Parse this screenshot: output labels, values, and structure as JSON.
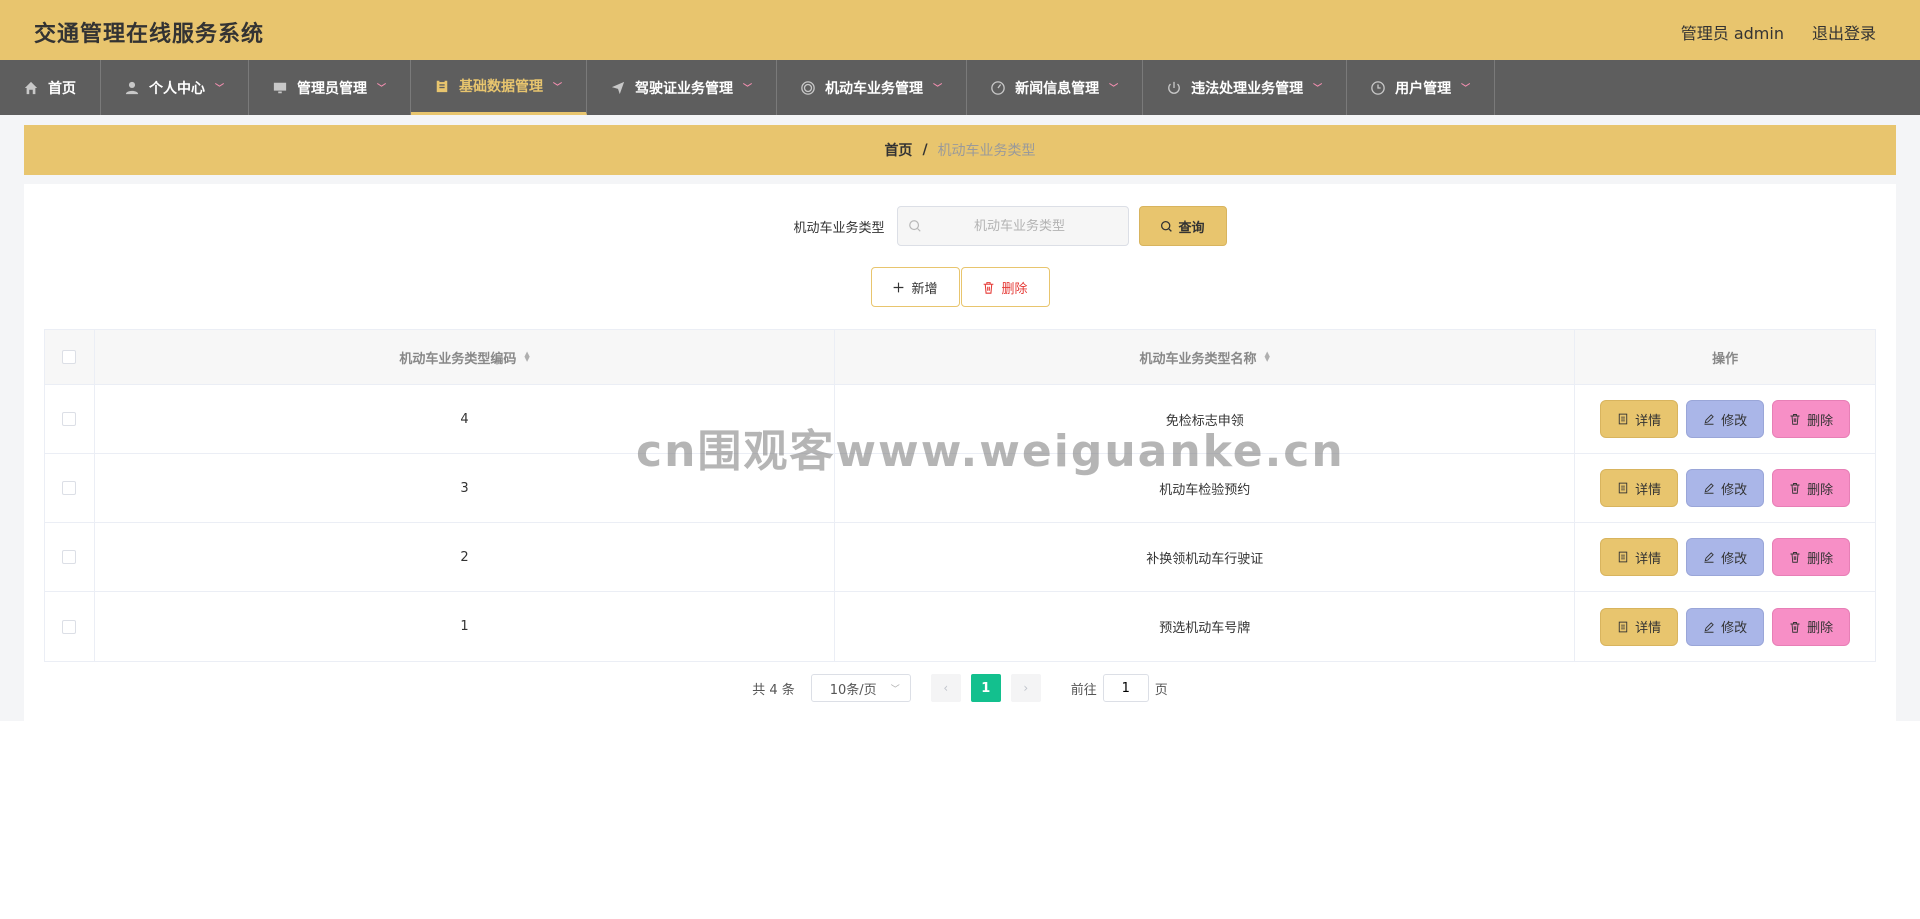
{
  "header": {
    "title": "交通管理在线服务系统",
    "user_label": "管理员 admin",
    "logout_label": "退出登录"
  },
  "nav": {
    "items": [
      {
        "label": "首页",
        "icon": "home-icon",
        "has_dropdown": false
      },
      {
        "label": "个人中心",
        "icon": "user-icon",
        "has_dropdown": true
      },
      {
        "label": "管理员管理",
        "icon": "monitor-icon",
        "has_dropdown": true
      },
      {
        "label": "基础数据管理",
        "icon": "clipboard-icon",
        "has_dropdown": true,
        "active": true
      },
      {
        "label": "驾驶证业务管理",
        "icon": "send-icon",
        "has_dropdown": true
      },
      {
        "label": "机动车业务管理",
        "icon": "target-icon",
        "has_dropdown": true
      },
      {
        "label": "新闻信息管理",
        "icon": "gauge-icon",
        "has_dropdown": true
      },
      {
        "label": "违法处理业务管理",
        "icon": "power-icon",
        "has_dropdown": true
      },
      {
        "label": "用户管理",
        "icon": "clock-icon",
        "has_dropdown": true
      }
    ],
    "chevron": "﹀"
  },
  "breadcrumb": {
    "home": "首页",
    "separator": "/",
    "current": "机动车业务类型"
  },
  "search": {
    "label": "机动车业务类型",
    "placeholder": "机动车业务类型",
    "value": "",
    "button_label": "查询"
  },
  "actions": {
    "add_label": "新增",
    "delete_label": "删除"
  },
  "table": {
    "columns": [
      "机动车业务类型编码",
      "机动车业务类型名称",
      "操作"
    ],
    "rows": [
      {
        "code": "4",
        "name": "免检标志申领"
      },
      {
        "code": "3",
        "name": "机动车检验预约"
      },
      {
        "code": "2",
        "name": "补换领机动车行驶证"
      },
      {
        "code": "1",
        "name": "预选机动车号牌"
      }
    ],
    "row_actions": {
      "detail": "详情",
      "edit": "修改",
      "delete": "删除"
    }
  },
  "pagination": {
    "total_text": "共 4 条",
    "page_size": "10条/页",
    "current_page": "1",
    "goto_prefix": "前往",
    "goto_value": "1",
    "goto_suffix": "页",
    "prev": "‹",
    "next": "›"
  },
  "watermark": "cn围观客www.weiguanke.cn",
  "colors": {
    "accent": "#e8c56e",
    "nav_bg": "#5e5e5e",
    "edit_btn": "#aab6e8",
    "delete_btn": "#f78fc6",
    "page_active": "#13c08e",
    "danger_text": "#e53935"
  }
}
